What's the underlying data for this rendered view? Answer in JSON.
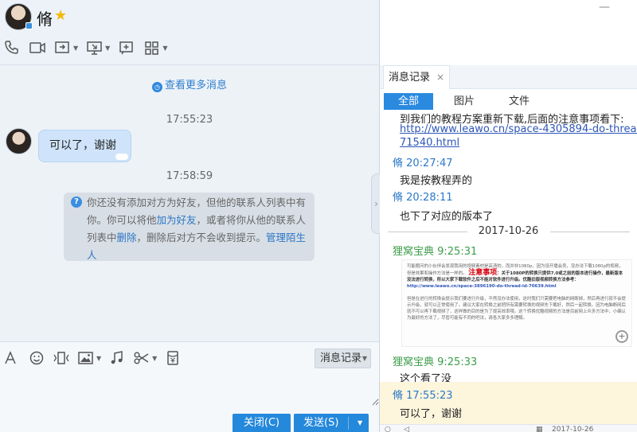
{
  "header": {
    "contact_name": "脩",
    "star_icon": "★"
  },
  "toolbar": {
    "items": [
      "phone-icon",
      "video-icon",
      "share-screen-icon",
      "remote-desktop-icon",
      "screenshot-icon",
      "apps-icon"
    ]
  },
  "chat": {
    "more_messages": "查看更多消息",
    "time1": "17:55:23",
    "bubble_text": "可以了，谢谢",
    "time2": "17:58:59",
    "notice": {
      "part1": "你还没有添加对方为好友，但他的联系人列表中有你。你可以将他",
      "add_friend": "加为好友",
      "part2": "，或者将你从他的联系人列表中",
      "delete": "删除",
      "part3": "，删除后对方不会收到提示。",
      "manage": "管理陌生人"
    }
  },
  "input_bar": {
    "tools": [
      "font-icon",
      "emoji-icon",
      "shake-icon",
      "image-icon",
      "music-icon",
      "scissors-icon",
      "red-packet-icon"
    ],
    "history_label": "消息记录",
    "input_value": "",
    "close_label": "关闭(C)",
    "send_label": "发送(S)"
  },
  "history": {
    "tab_label": "消息记录",
    "tab_close": "×",
    "filters": {
      "all": "全部",
      "pictures": "图片",
      "files": "文件"
    },
    "top_cut_text": "到我们的教程方案重新下载,后面的注意事项看下:",
    "link_line1": "http://www.leawo.cn/space-4305894-do-thread-id-",
    "link_line2": "71540.html",
    "msg1_sender": "脩 20:27:47",
    "msg1_text": "我是按教程弄的",
    "msg2_sender": "脩 20:28:11",
    "msg2_text": "也下了对应的版本了",
    "date_sep": "2017-10-26",
    "msg3_sender": "狸窝宝典 9:25:31",
    "doc": {
      "p1": "可能题问的小伙伴会发现我用的视频素材是高清的，而并非1080p，因为设开播会员，没办法下载1080p的视频，但是效果和操作方法是一样的。",
      "highlight": "注意事项",
      "p2": "：关于1080P的转换只提供7.0或之前的版本进行操作，最新版本没法进行转换，所以大家下载软件之后不能对软件进行升级。优酷旧版视频转换方法参考：",
      "url": "http://www.leawo.cn/space-3896190-do-thread-id-70639.html",
      "p3": "但是在进行的转换会提示我们要进行升级，不然没办法使用，这时我们只需要把电脑的网断掉，然后再进行就不会提示升级，就可以正常使用了。建议大家在转换之前把所有需要转换的视频先下载好，然后一起转换。因为电脑断网后就不可以再下载视频了，这样做的目的是为了提高效率哦。这个转换优酷视频的方法是目前网上众多方法中，小编认为最好的方法了，尽管可能有不同的吧法，请各大家多多理解。"
    },
    "msg4_sender": "狸窝宝典 9:25:33",
    "msg4_text": "这个看了没",
    "msg5_sender": "脩 17:55:23",
    "msg5_text": "可以了，谢谢",
    "bottom_date": "2017-10-26"
  }
}
